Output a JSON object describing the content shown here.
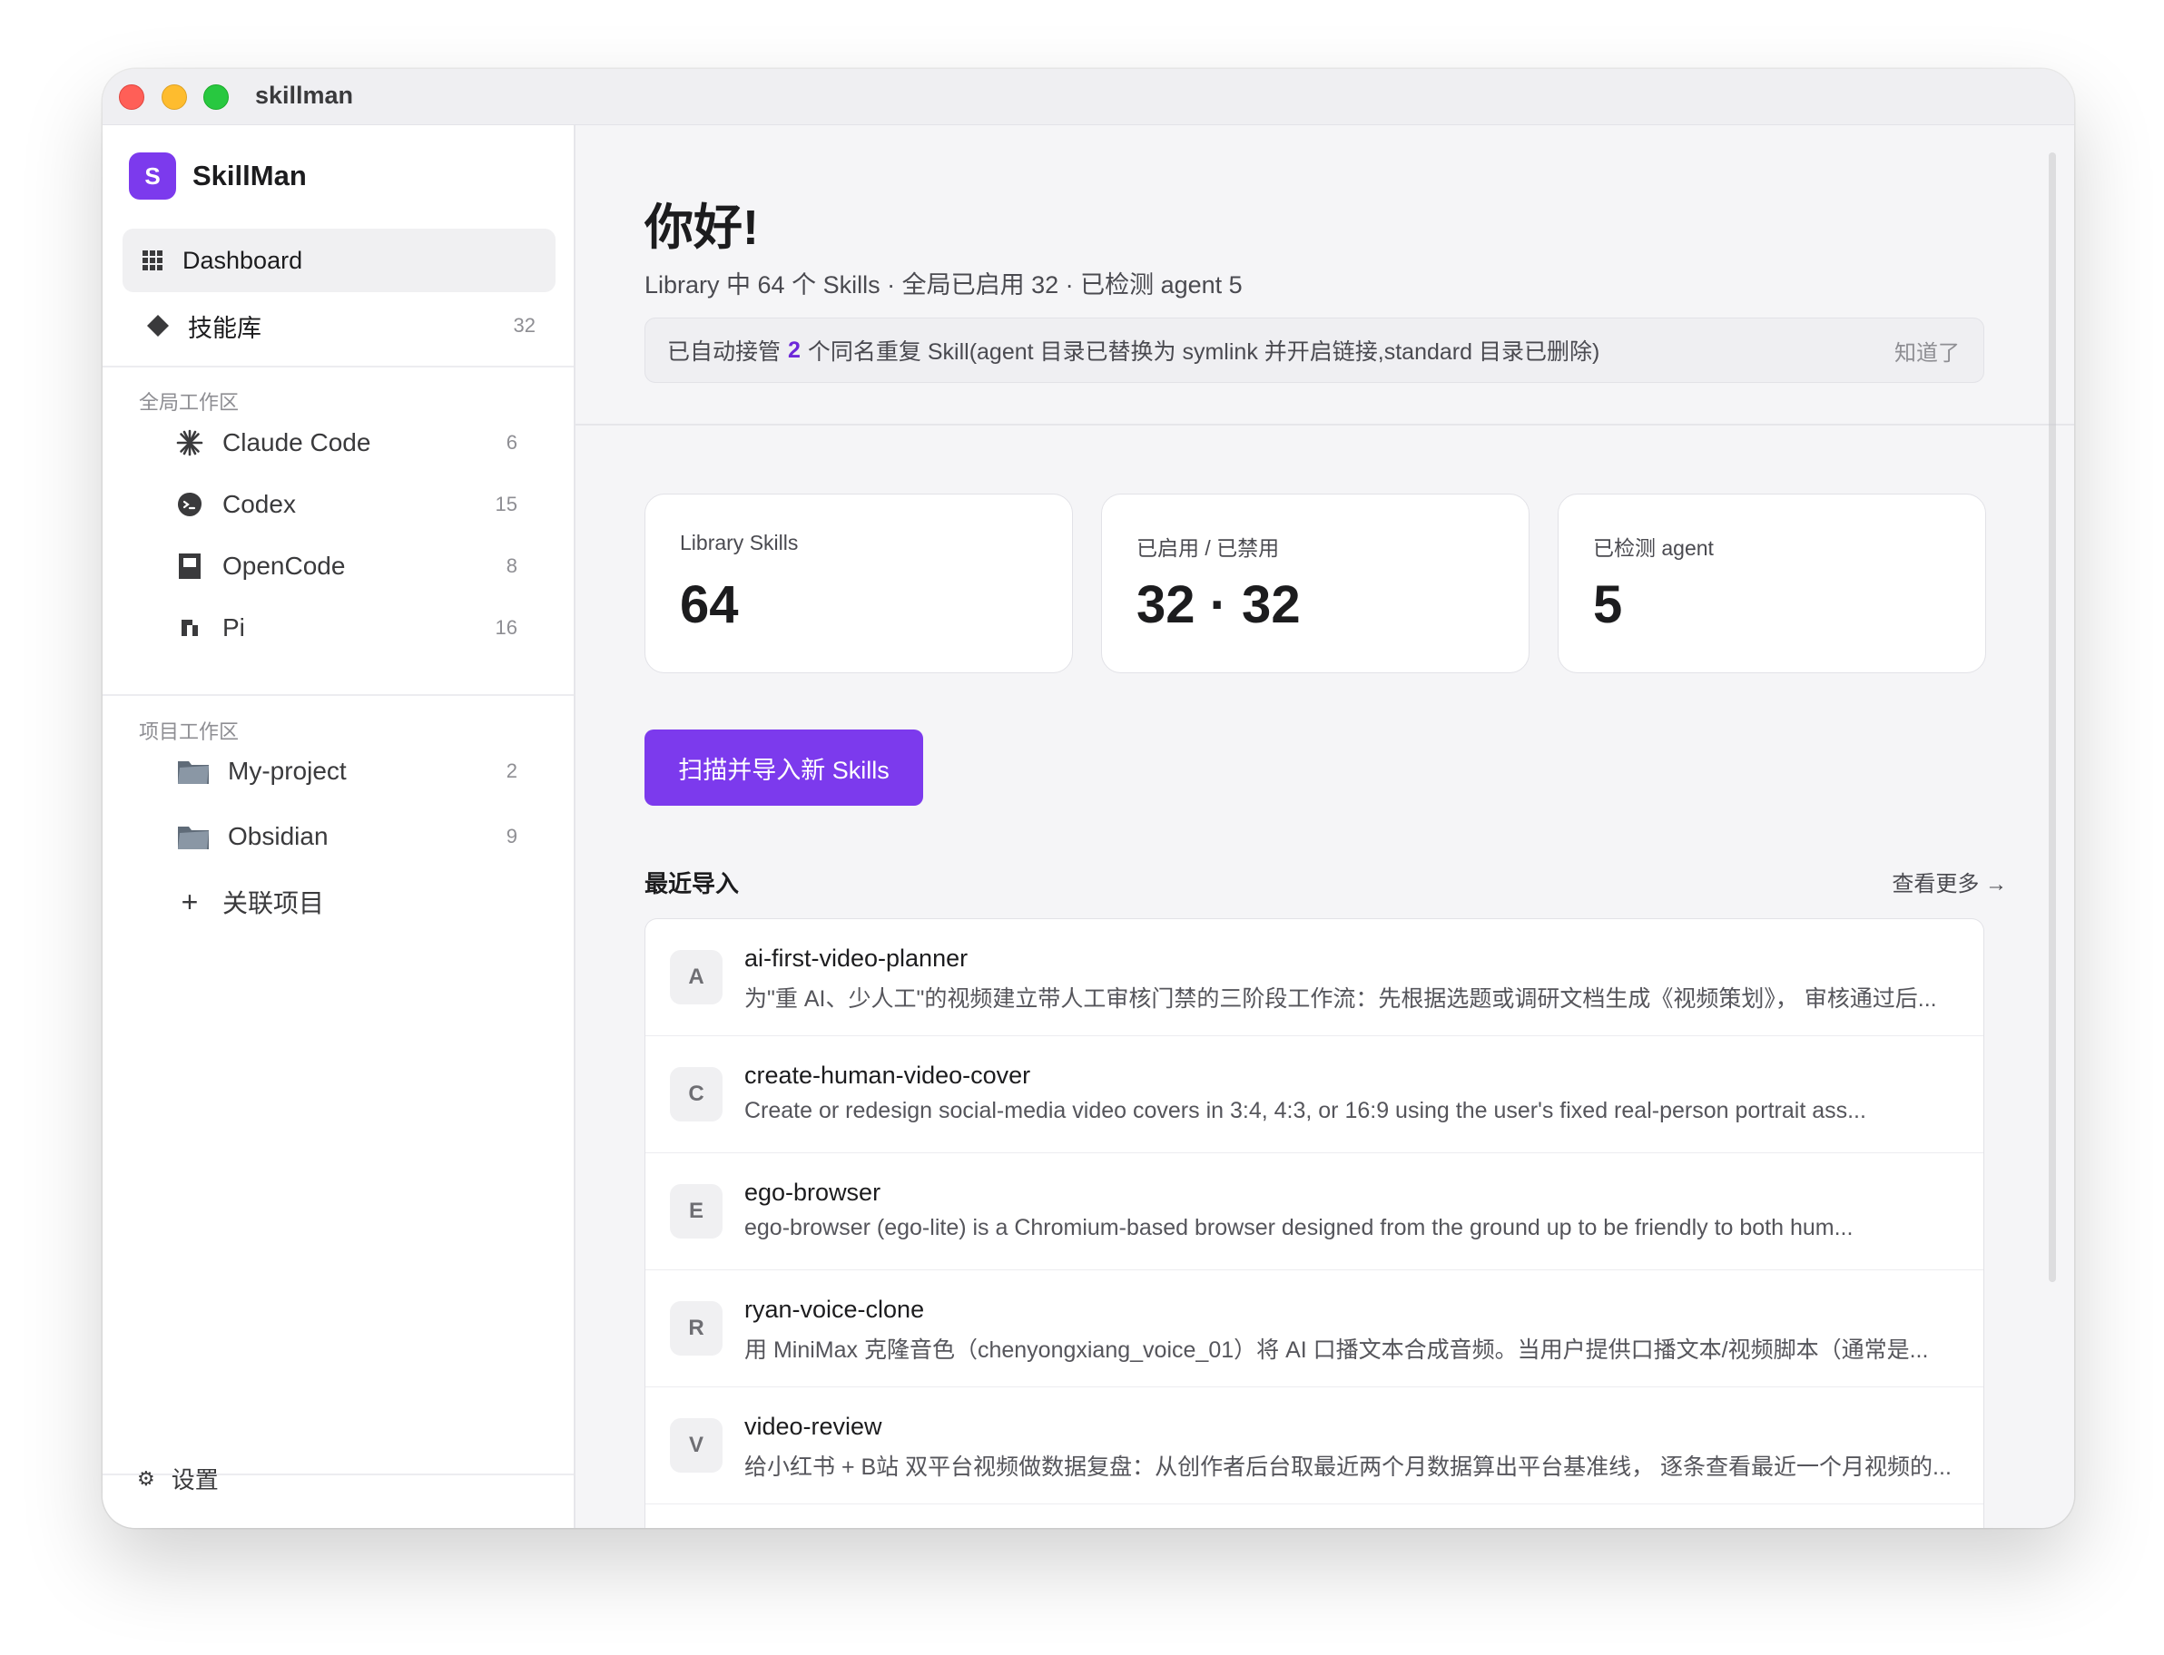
{
  "window": {
    "title": "skillman"
  },
  "sidebar": {
    "brand": {
      "logo": "S",
      "name": "SkillMan"
    },
    "nav": [
      {
        "label": "Dashboard",
        "icon": "grid-icon",
        "count": ""
      },
      {
        "label": "技能库",
        "icon": "diamond-icon",
        "count": "32"
      }
    ],
    "global_section_label": "全局工作区",
    "global_items": [
      {
        "label": "Claude Code",
        "icon": "claude-icon",
        "count": "6"
      },
      {
        "label": "Codex",
        "icon": "codex-icon",
        "count": "15"
      },
      {
        "label": "OpenCode",
        "icon": "opencode-icon",
        "count": "8"
      },
      {
        "label": "Pi",
        "icon": "pi-icon",
        "count": "16"
      }
    ],
    "project_section_label": "项目工作区",
    "project_items": [
      {
        "label": "My-project",
        "icon": "folder-icon",
        "count": "2"
      },
      {
        "label": "Obsidian",
        "icon": "folder-icon",
        "count": "9"
      }
    ],
    "link_project": {
      "icon": "+",
      "label": "关联项目"
    },
    "settings": {
      "icon": "⚙",
      "label": "设置"
    }
  },
  "main": {
    "title": "你好!",
    "subtitle": "Library 中 64 个 Skills · 全局已启用 32 · 已检测 agent 5",
    "notice": {
      "prefix": "已自动接管",
      "count": "2",
      "suffix": "个同名重复 Skill(agent 目录已替换为 symlink 并开启链接,standard 目录已删除)",
      "dismiss": "知道了"
    },
    "stats": [
      {
        "label": "Library Skills",
        "value": "64"
      },
      {
        "label": "已启用 / 已禁用",
        "value": "32 · 32"
      },
      {
        "label": "已检测 agent",
        "value": "5"
      }
    ],
    "scan_button": "扫描并导入新 Skills",
    "recent_title": "最近导入",
    "see_more": "查看更多 →",
    "recent": [
      {
        "letter": "A",
        "name": "ai-first-video-planner",
        "desc": "为\"重 AI、少人工\"的视频建立带人工审核门禁的三阶段工作流：先根据选题或调研文档生成《视频策划》， 审核通过后..."
      },
      {
        "letter": "C",
        "name": "create-human-video-cover",
        "desc": "Create or redesign social-media video covers in 3:4, 4:3, or 16:9 using the user's fixed real-person portrait ass..."
      },
      {
        "letter": "E",
        "name": "ego-browser",
        "desc": "ego-browser (ego-lite) is a Chromium-based browser designed from the ground up to be friendly to both hum..."
      },
      {
        "letter": "R",
        "name": "ryan-voice-clone",
        "desc": "用 MiniMax 克隆音色（chenyongxiang_voice_01）将 AI 口播文本合成音频。当用户提供口播文本/视频脚本（通常是..."
      },
      {
        "letter": "V",
        "name": "video-review",
        "desc": "给小红书 + B站 双平台视频做数据复盘：从创作者后台取最近两个月数据算出平台基准线， 逐条查看最近一个月视频的..."
      }
    ]
  }
}
